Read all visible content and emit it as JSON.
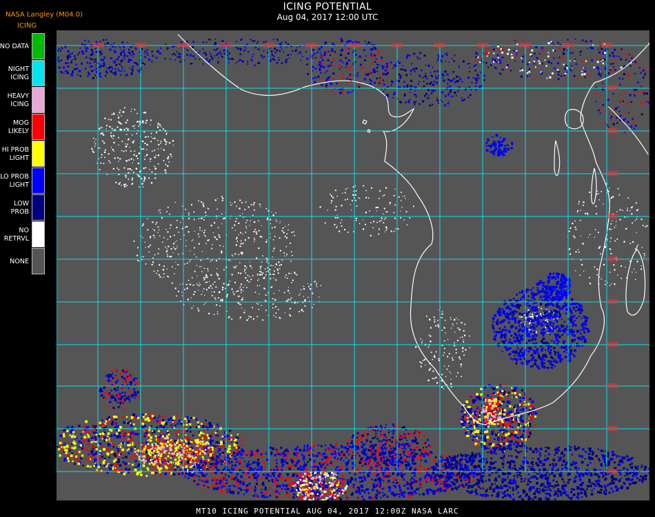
{
  "header": {
    "title": "ICING POTENTIAL",
    "subtitle": "Aug 04, 2017 12:00 UTC",
    "source": "NASA Langley (M04.0)",
    "legend_title": "ICING"
  },
  "legend": [
    {
      "line1": "NO DATA",
      "line2": "",
      "color": "#00bb00"
    },
    {
      "line1": "NIGHT",
      "line2": "ICING",
      "color": "#00e5ee"
    },
    {
      "line1": "HEAVY",
      "line2": "ICING",
      "color": "#e8a8d8"
    },
    {
      "line1": "MOG",
      "line2": "LIKELY",
      "color": "#ff0000"
    },
    {
      "line1": "HI PROB",
      "line2": "LIGHT",
      "color": "#ffff00"
    },
    {
      "line1": "LO PROB",
      "line2": "LIGHT",
      "color": "#0000ff"
    },
    {
      "line1": "LOW",
      "line2": "PROB",
      "color": "#000080"
    },
    {
      "line1": "NO",
      "line2": "RETRVL",
      "color": "#ffffff"
    },
    {
      "line1": "NONE",
      "line2": "",
      "color": "#555555"
    }
  ],
  "footer": "MT10  ICING POTENTIAL   AUG 04, 2017 12:00Z   NASA LARC",
  "colors": {
    "background": "#555555",
    "grid": "#00e5ee",
    "coast": "#ffffff",
    "grid_labels": "#ee3333"
  }
}
